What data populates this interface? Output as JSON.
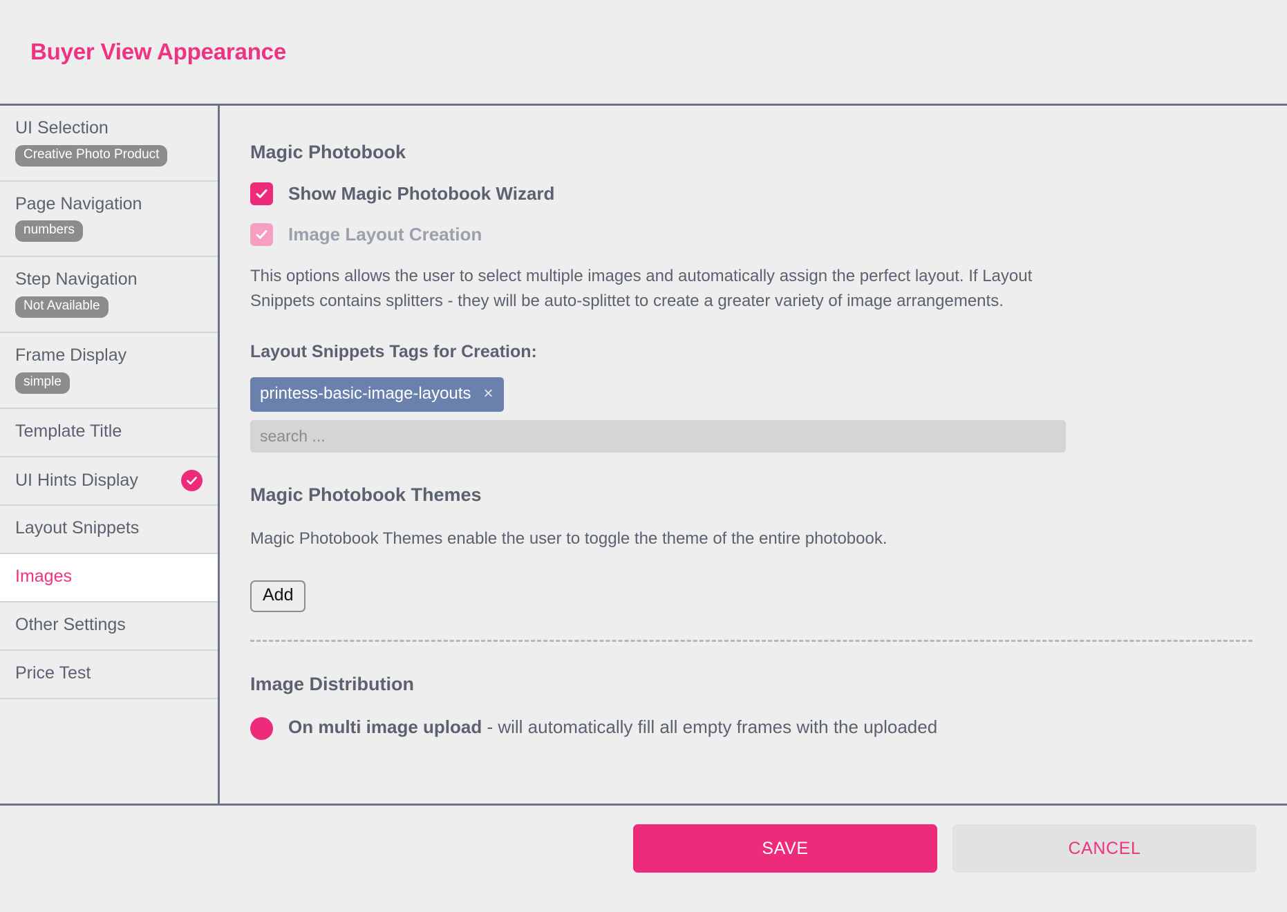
{
  "header": {
    "title": "Buyer View Appearance"
  },
  "colors": {
    "accent_pink": "#ee2a7b",
    "title_pink": "#ef3383",
    "muted_pink": "#f5a0c3",
    "text_slate": "#5a6270",
    "divider_slate": "#6b7486",
    "tag_blue": "#6b81ad",
    "badge_grey": "#8c8c8c",
    "page_bg": "#eeeeee"
  },
  "sidebar": {
    "items": [
      {
        "label": "UI Selection",
        "badge": "Creative Photo Product",
        "selected": false,
        "check": false
      },
      {
        "label": "Page Navigation",
        "badge": "numbers",
        "selected": false,
        "check": false
      },
      {
        "label": "Step Navigation",
        "badge": "Not Available",
        "selected": false,
        "check": false
      },
      {
        "label": "Frame Display",
        "badge": "simple",
        "selected": false,
        "check": false
      },
      {
        "label": "Template Title",
        "badge": null,
        "selected": false,
        "check": false
      },
      {
        "label": "UI Hints Display",
        "badge": null,
        "selected": false,
        "check": true
      },
      {
        "label": "Layout Snippets",
        "badge": null,
        "selected": false,
        "check": false
      },
      {
        "label": "Images",
        "badge": null,
        "selected": true,
        "check": false
      },
      {
        "label": "Other Settings",
        "badge": null,
        "selected": false,
        "check": false
      },
      {
        "label": "Price Test",
        "badge": null,
        "selected": false,
        "check": false
      }
    ]
  },
  "main": {
    "magic_photobook": {
      "heading": "Magic Photobook",
      "wizard_checkbox": {
        "label": "Show Magic Photobook Wizard",
        "checked": true,
        "disabled": false
      },
      "layout_creation_checkbox": {
        "label": "Image Layout Creation",
        "checked": true,
        "disabled": true
      },
      "description": "This options allows the user to select multiple images and automatically assign the perfect layout. If Layout Snippets contains splitters - they will be auto-splittet to create a greater variety of image arrangements.",
      "tags_label": "Layout Snippets Tags for Creation:",
      "tags": [
        "printess-basic-image-layouts"
      ],
      "tag_remove_icon": "×",
      "search_placeholder": "search ...",
      "search_value": ""
    },
    "themes": {
      "heading": "Magic Photobook Themes",
      "description": "Magic Photobook Themes enable the user to toggle the theme of the entire photobook.",
      "add_label": "Add"
    },
    "image_distribution": {
      "heading": "Image Distribution",
      "option_strong": "On multi image upload",
      "option_rest": " - will automatically fill all empty frames with the uploaded",
      "selected": true
    }
  },
  "footer": {
    "save_label": "SAVE",
    "cancel_label": "CANCEL"
  }
}
